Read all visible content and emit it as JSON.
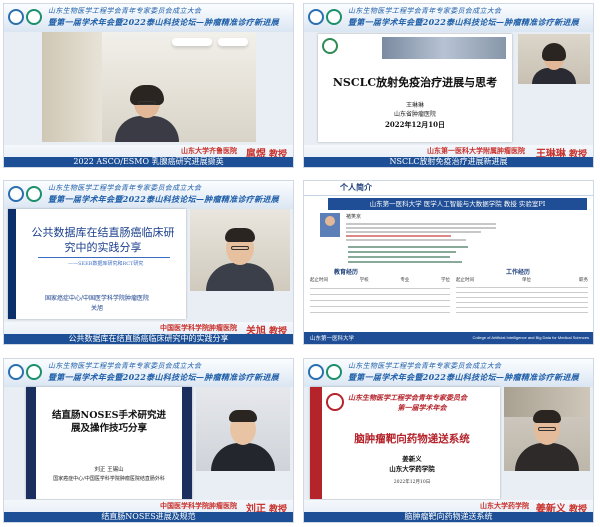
{
  "header": {
    "line1": "山东生物医学工程学会青年专家委员会成立大会",
    "line2": "暨第一届学术年会暨2022泰山科技论坛—肿瘤精准诊疗新进展"
  },
  "panels": [
    {
      "affiliation": "山东大学齐鲁医院",
      "speaker": "扈煜",
      "title_suffix": "教授",
      "topic": "2022 ASCO/ESMO 乳腺癌研究进展撷英"
    },
    {
      "affiliation": "山东第一医科大学附属肿瘤医院",
      "speaker": "王琳琳",
      "title_suffix": "教授",
      "topic": "NSCLC放射免疫治疗进展新进展",
      "slide": {
        "title": "NSCLC放射免疫治疗进展与思考",
        "author": "王琳琳",
        "org": "山东省肿瘤医院",
        "date": "2022年12月10日"
      }
    },
    {
      "affiliation": "中国医学科学院肿瘤医院",
      "speaker": "关旭",
      "title_suffix": "教授",
      "topic": "公共数据库在结直肠癌临床研究中的实践分享",
      "slide": {
        "title": "公共数据库在结直肠癌临床研究中的实践分享",
        "subtitle": "——SEER数据库研究和RCT研究",
        "org": "国家癌症中心/中国医学科学院肿瘤医院",
        "author": "关旭"
      }
    },
    {
      "slide": {
        "tab": "个人简介",
        "banner": "山东第一医科大学 医学人工智能与大数据学院 教授 实验室PI",
        "name": "褚笑京",
        "edu_title": "教育经历",
        "work_title": "工作经历",
        "edu_headers": [
          "起止时间",
          "学校",
          "专业",
          "学位"
        ],
        "work_headers": [
          "起止时间",
          "单位",
          "职务"
        ],
        "footer_left": "山东第一医科大学",
        "footer_right": "College of Artificial Intelligence and Big Data for Medical Sciences"
      }
    },
    {
      "affiliation": "中国医学科学院肿瘤医院",
      "speaker": "刘正",
      "title_suffix": "教授",
      "topic": "结直肠NOSES进展及规范",
      "slide": {
        "title": "结直肠NOSES手术研究进展及操作技巧分享",
        "author": "刘正 王锡山",
        "org": "国家癌症中心/中国医学科学院肿瘤医院结直肠外科"
      }
    },
    {
      "affiliation": "山东大学药学院",
      "speaker": "姜新义",
      "title_suffix": "教授",
      "topic": "脑肿瘤靶向药物递送系统",
      "slide": {
        "header1": "山东生物医学工程学会青年专家委员会",
        "header2": "第一届学术年会",
        "title": "脑肿瘤靶向药物递送系统",
        "author": "姜新义",
        "org": "山东大学药学院",
        "date": "2022年12月10日"
      }
    }
  ]
}
